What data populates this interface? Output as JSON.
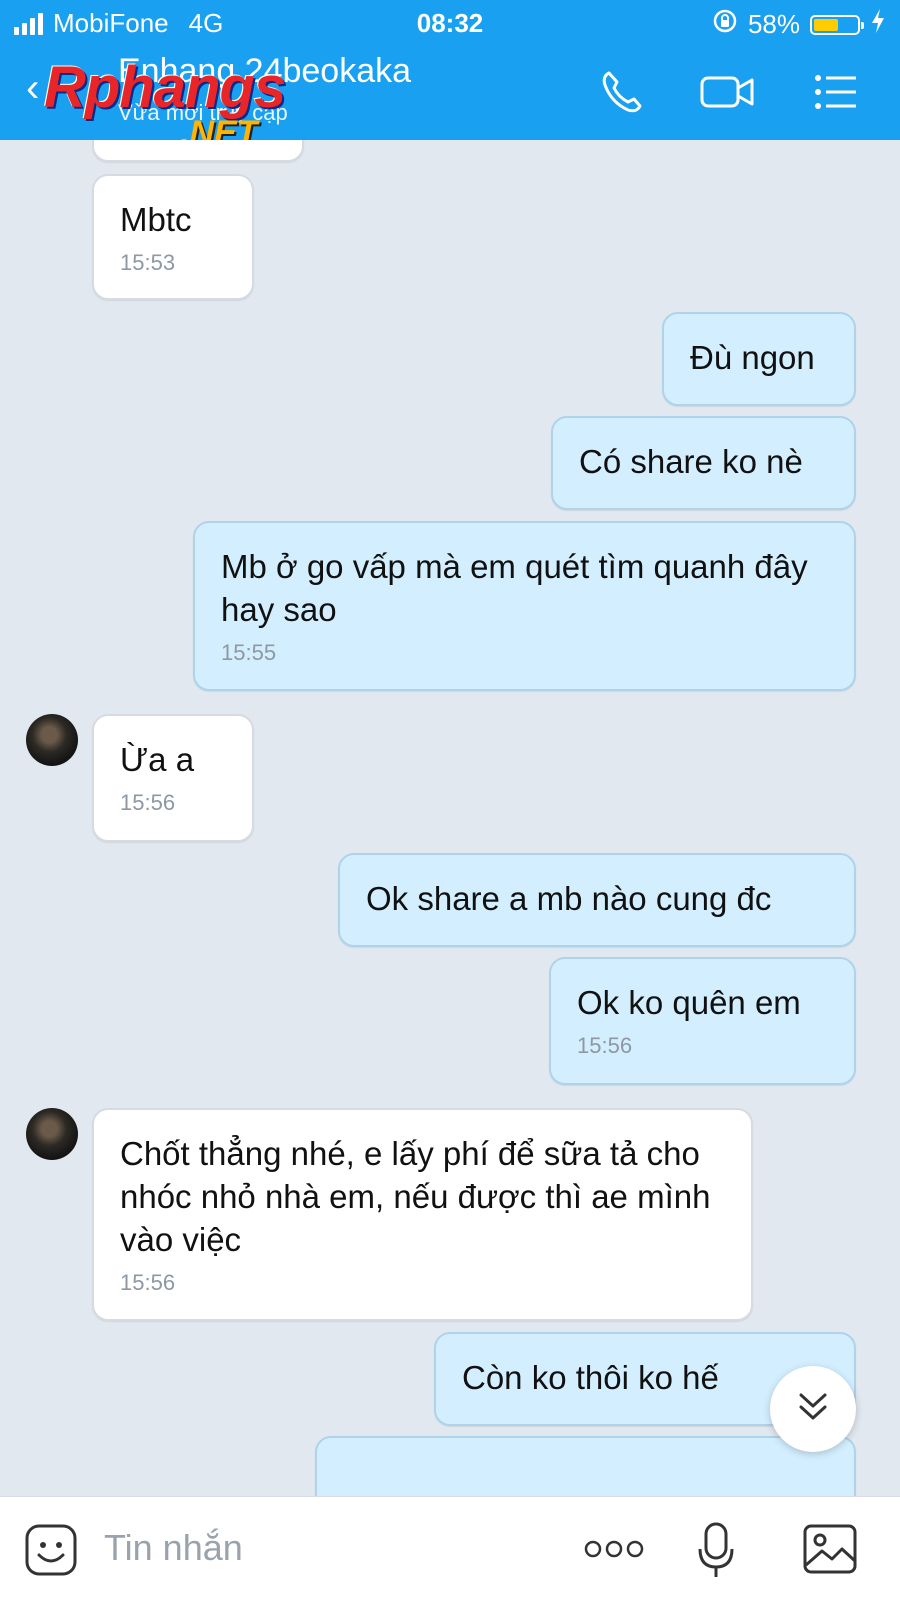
{
  "status": {
    "carrier": "MobiFone",
    "network": "4G",
    "time": "08:32",
    "battery": "58%",
    "battery_level": 0.58
  },
  "header": {
    "contact_name": "Enhang 24beokaka",
    "subtitle": "Vừa mới truy cập",
    "watermark": "Rphangs",
    "watermark_suffix": ".NET",
    "icons": [
      "back-icon",
      "phone-icon",
      "video-icon",
      "menu-icon"
    ]
  },
  "messages": [
    {
      "side": "in",
      "text": "Mbtc",
      "time": "15:53"
    },
    {
      "side": "out",
      "text": "Đù ngon",
      "time": ""
    },
    {
      "side": "out",
      "text": "Có share ko nè",
      "time": ""
    },
    {
      "side": "out",
      "text": "Mb ở go vấp mà em quét tìm quanh đây hay sao",
      "time": "15:55"
    },
    {
      "side": "in",
      "text": "Ừa a",
      "time": "15:56"
    },
    {
      "side": "out",
      "text": "Ok share a mb nào cung đc",
      "time": ""
    },
    {
      "side": "out",
      "text": "Ok ko quên em",
      "time": "15:56"
    },
    {
      "side": "in",
      "text": "Chốt thẳng nhé, e lấy phí để sữa tả cho nhóc nhỏ nhà em, nếu được thì ae mình vào việc",
      "time": "15:56"
    },
    {
      "side": "out",
      "text": "Còn ko thôi ko hế",
      "time": ""
    }
  ],
  "input": {
    "placeholder": "Tin nhắn",
    "icons": [
      "emoji-icon",
      "more-icon",
      "microphone-icon",
      "image-icon"
    ]
  },
  "colors": {
    "header": "#1aa0f0",
    "background": "#e2e8f0",
    "incoming_bubble": "#ffffff",
    "outgoing_bubble": "#d3efff"
  }
}
